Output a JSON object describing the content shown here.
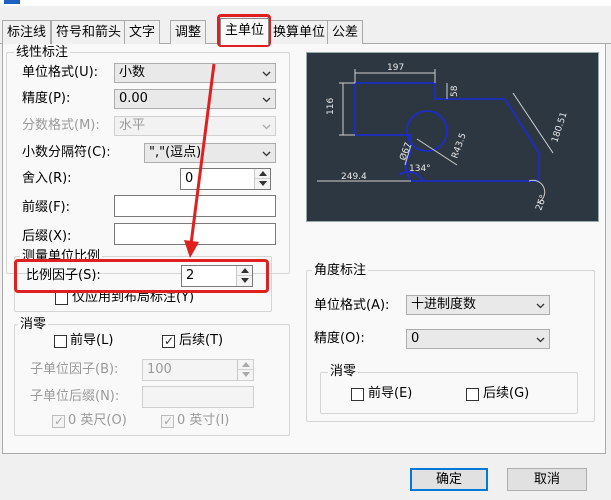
{
  "tabs": [
    "标注线",
    "符号和箭头",
    "文字",
    "调整",
    "主单位",
    "换算单位",
    "公差"
  ],
  "active_tab": "主单位",
  "linear": {
    "title": "线性标注",
    "unit_format_label": "单位格式(U):",
    "unit_format_value": "小数",
    "precision_label": "精度(P):",
    "precision_value": "0.00",
    "fraction_format_label": "分数格式(M):",
    "fraction_format_value": "水平",
    "decimal_sep_label": "小数分隔符(C):",
    "decimal_sep_value": "\",\"(逗点)",
    "round_label": "舍入(R):",
    "round_value": "0",
    "prefix_label": "前缀(F):",
    "prefix_value": "",
    "suffix_label": "后缀(X):",
    "suffix_value": ""
  },
  "measure_scale": {
    "title": "测量单位比例",
    "scale_label": "比例因子(S):",
    "scale_value": "2",
    "layout_only_label": "仅应用到布局标注(Y)"
  },
  "zero_supp": {
    "title": "消零",
    "leading_label": "前导(L)",
    "trailing_label": "后续(T)",
    "subunit_factor_label": "子单位因子(B):",
    "subunit_factor_value": "100",
    "subunit_suffix_label": "子单位后缀(N):",
    "subunit_suffix_value": "",
    "feet_label": "0 英尺(O)",
    "inches_label": "0 英寸(I)"
  },
  "angular": {
    "title": "角度标注",
    "unit_format_label": "单位格式(A):",
    "unit_format_value": "十进制度数",
    "precision_label": "精度(O):",
    "precision_value": "0",
    "zero_title": "消零",
    "leading_label": "前导(E)",
    "trailing_label": "后续(G)"
  },
  "preview": {
    "dims": [
      "197",
      "116",
      "58",
      "180.51",
      "R43.5",
      "Ø67",
      "134°",
      "249.4",
      "26°"
    ]
  },
  "buttons": {
    "ok": "确定",
    "cancel": "取消"
  },
  "colors": {
    "annotation_red": "#e02020",
    "preview_bg": "#2d3741",
    "geometry_blue": "#1a2bd6"
  }
}
